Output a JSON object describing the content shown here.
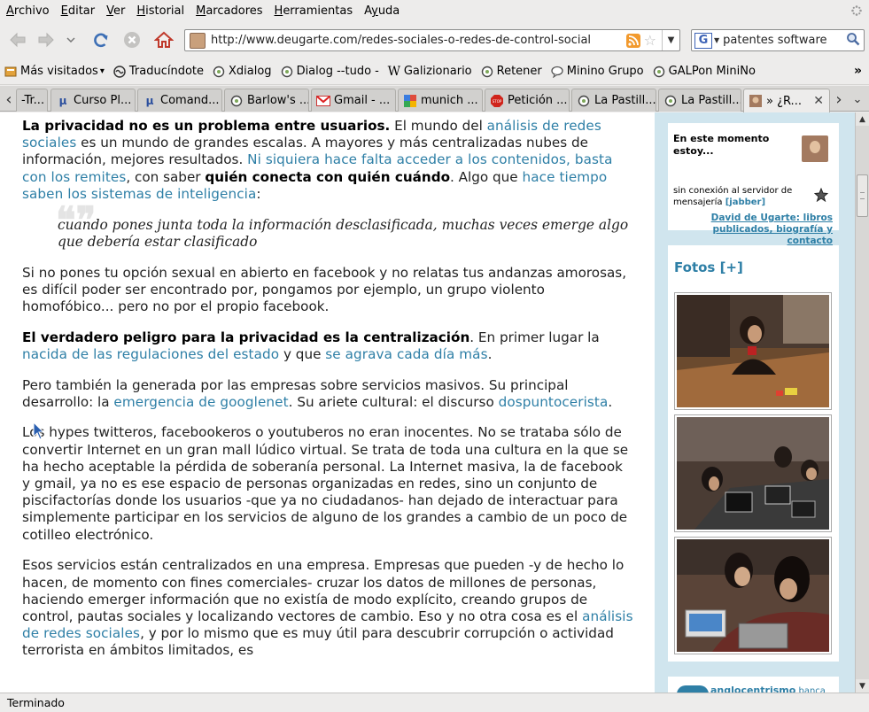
{
  "menu": [
    "Archivo",
    "Editar",
    "Ver",
    "Historial",
    "Marcadores",
    "Herramientas",
    "Ayuda"
  ],
  "menu_accel": [
    "A",
    "E",
    "V",
    "H",
    "M",
    "H",
    "y"
  ],
  "nav": {
    "url": "http://www.deugarte.com/redes-sociales-o-redes-de-control-social",
    "search_engine": "G",
    "search_query": "patentes software"
  },
  "bookmarks": [
    {
      "label": "Más visitados",
      "icon": "bookmarks-folder-icon",
      "dropdown": true
    },
    {
      "label": "Traducíndote",
      "icon": "wave-icon"
    },
    {
      "label": "Xdialog",
      "icon": "feed-circle-icon"
    },
    {
      "label": "Dialog --tudo -",
      "icon": "feed-circle-icon"
    },
    {
      "label": "Galizionario",
      "icon": "wikipedia-w-icon"
    },
    {
      "label": "Retener",
      "icon": "feed-circle-icon"
    },
    {
      "label": "Minino Grupo",
      "icon": "chat-bubble-icon"
    },
    {
      "label": "GALPon MiniNo",
      "icon": "feed-circle-icon"
    }
  ],
  "tabs": [
    {
      "label": "-Tr...",
      "icon": "none"
    },
    {
      "label": "Curso Pl...",
      "icon": "mu-icon"
    },
    {
      "label": "Comand...",
      "icon": "mu-icon"
    },
    {
      "label": "Barlow's ...",
      "icon": "feed-circle-icon"
    },
    {
      "label": "Gmail - ...",
      "icon": "gmail-icon"
    },
    {
      "label": "munich ...",
      "icon": "google-icon"
    },
    {
      "label": "Petición ...",
      "icon": "stop-icon"
    },
    {
      "label": "La Pastill...",
      "icon": "feed-circle-icon"
    },
    {
      "label": "La Pastill...",
      "icon": "feed-circle-icon"
    },
    {
      "label": "» ¿R...",
      "icon": "avatar-icon",
      "active": true
    }
  ],
  "article": {
    "p1": {
      "b1": "La privacidad no es un problema entre usuarios.",
      "t1": " El mundo del ",
      "a1": "análisis de redes sociales",
      "t2": " es un mundo de grandes escalas. A mayores y más centralizadas nubes de información, mejores resultados. ",
      "a2": "Ni siquiera hace falta acceder a los contenidos, basta con los remites",
      "t3": ", con saber ",
      "b2": "quién conecta con quién cuándo",
      "t4": ". Algo que ",
      "a3": "hace tiempo saben los sistemas de inteligencia",
      "t5": ":"
    },
    "quote": "cuando pones junta toda la información desclasificada, muchas veces emerge algo que debería estar clasificado",
    "p2": "Si no pones tu opción sexual en abierto en facebook y no relatas tus andanzas amorosas, es difícil poder ser encontrado por, pongamos por ejemplo, un grupo violento homofóbico... pero no por el propio facebook.",
    "p3": {
      "b1": "El verdadero peligro para la privacidad es la centralización",
      "t1": ". En primer lugar la ",
      "a1": "nacida de las regulaciones del estado",
      "t2": " y que ",
      "a2": "se agrava cada día más",
      "t3": "."
    },
    "p4": {
      "t1": "Pero también la generada por las empresas sobre servicios masivos. Su principal desarrollo: la ",
      "a1": "emergencia de googlenet",
      "t2": ". Su ariete cultural: el discurso ",
      "a2": "dospuntocerista",
      "t3": "."
    },
    "p5": "Los hypes twitteros, facebookeros o youtuberos no eran inocentes. No se trataba sólo de convertir Internet en un gran mall lúdico virtual. Se trata de toda una cultura en la que se ha hecho aceptable la pérdida de soberanía personal. La Internet masiva, la de facebook y gmail, ya no es ese espacio de personas organizadas en redes, sino un conjunto de piscifactorías donde los usuarios -que ya no ciudadanos- han dejado de interactuar para simplemente participar en los servicios de alguno de los grandes a cambio de un poco de cotilleo electrónico.",
    "p6": {
      "t1": "Esos servicios están centralizados en una empresa. Empresas que pueden -y de hecho lo hacen, de momento con fines comerciales- cruzar los datos de millones de personas, haciendo emerger información que no existía de modo explícito, creando grupos de control, pautas sociales y localizando vectores de cambio. Eso y no otra cosa es el ",
      "a1": "análisis de redes sociales",
      "t2": ", y por lo mismo que es muy útil para descubrir corrupción o actividad terrorista en ámbitos limitados, es"
    }
  },
  "sidebar": {
    "now_title": "En este momento estoy...",
    "status_text": "sin conexión al servidor de mensajería ",
    "status_link": "[jabber]",
    "profile_link": "David de Ugarte: libros publicados, biografía y contacto",
    "photos_title": "Fotos [+]",
    "next_title": "anglocentrismo",
    "next_sub": " banca"
  },
  "status": "Terminado",
  "colors": {
    "link": "#2e7fa6",
    "sidebar_bg": "#d0e5ee",
    "chrome_bg": "#edeceb"
  }
}
